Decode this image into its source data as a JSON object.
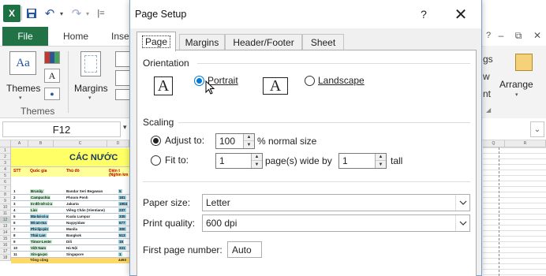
{
  "excel": {
    "logo": "X",
    "qat": {
      "save_icon": "save-icon",
      "undo_glyph": "↶",
      "redo_glyph": "↷",
      "dropdown_glyph": "▾",
      "customize_glyph": "|=",
      "separator_glyph": "|"
    },
    "tabs": {
      "file": "File",
      "home": "Home",
      "insert_fragment": "Inse"
    },
    "window_controls": {
      "ribbon_options": "?",
      "minimize": "–",
      "restore": "⧉",
      "close": "✕"
    },
    "ribbon": {
      "themes_glyph": "Aa",
      "themes_label": "Themes",
      "themes_group_label": "Themes",
      "fonts_glyph": "A",
      "margins_label": "Margins",
      "arrange_label": "Arrange",
      "right_fragments": [
        "gs",
        "w",
        "nt"
      ]
    },
    "name_box": "F12",
    "sheet": {
      "columns": [
        "A",
        "B",
        "C",
        "D"
      ],
      "right_columns": [
        "Q",
        "R"
      ],
      "title": "CÁC NƯỚC",
      "header_cells": [
        "STT",
        "Quốc gia",
        "Thủ đô",
        "Diện t"
      ],
      "sub_header": "(Nghìn km",
      "rows": [
        [
          "1",
          "Brunây",
          "Bandar Seri Begawan",
          "5"
        ],
        [
          "2",
          "Campuchia",
          "Phnom Penh",
          "181"
        ],
        [
          "3",
          "In-đô-nê-xi-a",
          "Jakarta",
          "1904"
        ],
        [
          "4",
          "Lào",
          "Viêng Chăn (Vientiane)",
          "237"
        ],
        [
          "5",
          "Ma-lai-xi-a",
          "Kuala Lumpur",
          "330"
        ],
        [
          "6",
          "Mi-an-ma",
          "Naypyidaw",
          "677"
        ],
        [
          "7",
          "Phi-lip-pin",
          "Manila",
          "300"
        ],
        [
          "8",
          "Thái Lan",
          "Bangkok",
          "513"
        ],
        [
          "9",
          "Timor-Leste",
          "Dili",
          "15"
        ],
        [
          "10",
          "Việt Nam",
          "Hà Nội",
          "331"
        ],
        [
          "11",
          "Xin-ga-po",
          "Singapore",
          "1"
        ]
      ],
      "total_label": "Tổng cộng",
      "total_value": "4493",
      "row_numbers": [
        "1",
        "2",
        "3",
        "4",
        "5",
        "6",
        "7",
        "8",
        "9",
        "10",
        "11",
        "12",
        "13",
        "14",
        "15",
        "16",
        "17",
        "18"
      ]
    }
  },
  "dialog": {
    "title": "Page Setup",
    "help": "?",
    "close": "✕",
    "tabs": [
      "Page",
      "Margins",
      "Header/Footer",
      "Sheet"
    ],
    "active_tab": "Page",
    "orientation": {
      "label": "Orientation",
      "glyph": "A",
      "portrait": "Portrait",
      "landscape": "Landscape",
      "selected": "Portrait"
    },
    "scaling": {
      "label": "Scaling",
      "adjust_to": "Adjust to:",
      "adjust_value": "100",
      "normal_size_suffix": "% normal size",
      "fit_to": "Fit to:",
      "pages_wide": "1",
      "wide_by": "page(s) wide by",
      "pages_tall": "1",
      "tall": "tall",
      "selected": "Adjust to"
    },
    "paper_size": {
      "label": "Paper size:",
      "value": "Letter"
    },
    "print_quality": {
      "label": "Print quality:",
      "value": "600 dpi"
    },
    "first_page_number": {
      "label": "First page number:",
      "value": "Auto"
    },
    "spin_up_glyph": "▲",
    "spin_down_glyph": "▼"
  },
  "colors": {
    "excel_green": "#217346",
    "selection_blue": "#0078d7",
    "title_yellow": "#ffff66",
    "total_yellow": "#ffd966"
  }
}
